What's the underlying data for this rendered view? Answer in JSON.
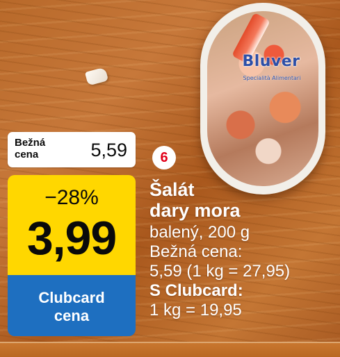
{
  "product_photo": {
    "brand": "Bluver",
    "brand_subtitle": "Specialità Alimentari"
  },
  "regular_price_box": {
    "label": "Bežná\ncena",
    "value": "5,59"
  },
  "clubcard_box": {
    "discount": "−28%",
    "price": "3,99",
    "label": "Clubcard\ncena",
    "colors": {
      "price_bg": "#ffd700",
      "label_bg": "#1e6fc0"
    }
  },
  "item_number": "6",
  "product": {
    "name": "Šalát\ndary mora",
    "pack": "balený, 200 g",
    "regular_price_label": "Bežná cena:",
    "regular_price_detail": "5,59 (1 kg = 27,95)",
    "clubcard_heading": "S Clubcard:",
    "clubcard_unit_price": "1 kg = 19,95"
  }
}
